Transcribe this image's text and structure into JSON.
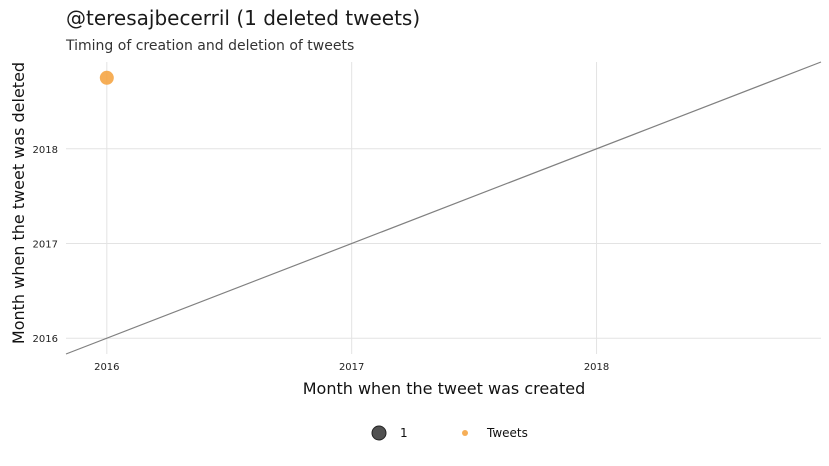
{
  "chart_data": {
    "type": "scatter",
    "title": "@teresajbecerril (1 deleted tweets)",
    "subtitle": "Timing of creation and deletion of tweets",
    "xlabel": "Month when the tweet was created",
    "ylabel": "Month when the tweet was deleted",
    "x_ticks": [
      "2016",
      "2017",
      "2018"
    ],
    "y_ticks": [
      "2016",
      "2017",
      "2018"
    ],
    "xlim": [
      "2015-11",
      "2018-12"
    ],
    "ylim": [
      "2015-11",
      "2018-12"
    ],
    "grid": true,
    "reference_line": "y = x",
    "reference_line_color": "#808080",
    "series": [
      {
        "name": "Tweets",
        "color": "#f5a03a",
        "points": [
          {
            "x": "2016-01",
            "y": "2018-10",
            "size": 1
          }
        ]
      }
    ],
    "legend": {
      "position": "bottom",
      "size_label": "1",
      "color_label": "Tweets"
    }
  }
}
